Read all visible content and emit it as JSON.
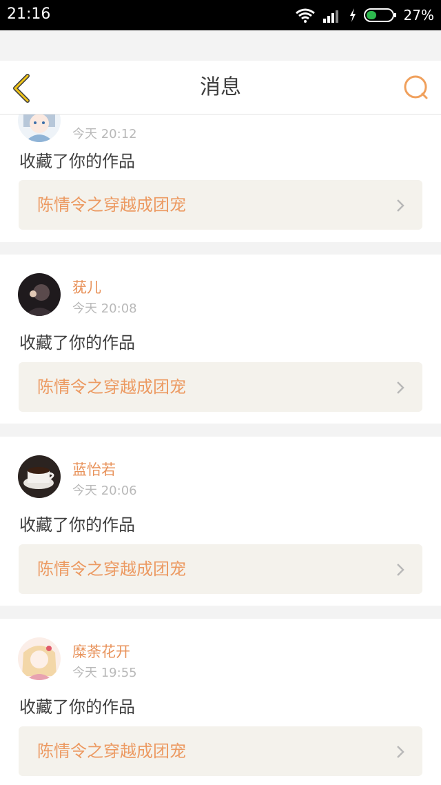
{
  "status_bar": {
    "time": "21:16",
    "battery": "27%",
    "icons": [
      "wifi-icon",
      "signal-icon",
      "charging-icon",
      "battery-icon"
    ],
    "battery_color": "#2db84d"
  },
  "header": {
    "title": "消息",
    "back_icon": "chevron-left-icon",
    "search_icon": "search-icon",
    "accent_back": "#f0c419",
    "accent_search": "#f0a05c"
  },
  "messages": [
    {
      "user": "",
      "time": "今天 20:12",
      "action": "收藏了你的作品",
      "work": "陈情令之穿越成团宠",
      "avatar": "anime-girl-blue-avatar"
    },
    {
      "user": "莸儿",
      "time": "今天 20:08",
      "action": "收藏了你的作品",
      "work": "陈情令之穿越成团宠",
      "avatar": "dark-photo-avatar"
    },
    {
      "user": "蓝怡若",
      "time": "今天 20:06",
      "action": "收藏了你的作品",
      "work": "陈情令之穿越成团宠",
      "avatar": "coffee-cup-avatar"
    },
    {
      "user": "糜荼花开",
      "time": "今天 19:55",
      "action": "收藏了你的作品",
      "work": "陈情令之穿越成团宠",
      "avatar": "anime-girl-pink-avatar"
    }
  ],
  "colors": {
    "username": "#e8925a",
    "work_title": "#ec9a62",
    "work_bg": "#f4f2ec",
    "time": "#b9b9b9",
    "divider": "#f3f3f3"
  }
}
